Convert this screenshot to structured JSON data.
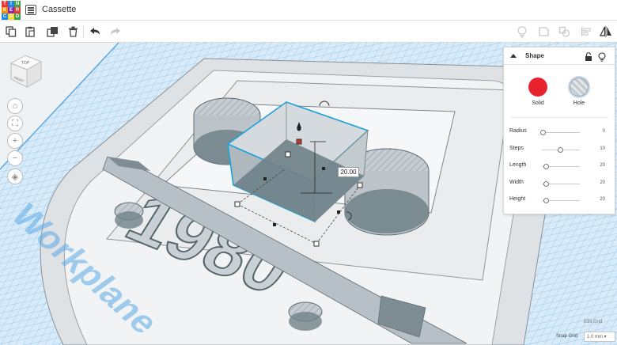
{
  "app": {
    "logo_letters": [
      "T",
      "I",
      "N",
      "K",
      "E",
      "R",
      "C",
      "A",
      "D"
    ],
    "document_title": "Cassette"
  },
  "toolbar": {
    "left_tools": [
      "copy-icon",
      "paste-icon",
      "duplicate-icon",
      "trash-icon",
      "undo-icon",
      "redo-icon"
    ],
    "right_tools": [
      "lightbulb-icon",
      "group-icon",
      "ungroup-icon",
      "align-icon",
      "mirror-icon"
    ]
  },
  "view_controls": {
    "cube_top": "TOP",
    "cube_front": "FRONT",
    "buttons": [
      "home-icon",
      "fit-icon",
      "zoom-in-icon",
      "zoom-out-icon",
      "perspective-icon"
    ]
  },
  "workspace": {
    "workplane_label": "Workplane",
    "engraved_text": "1980",
    "dimension_value": "20.00"
  },
  "shape_panel": {
    "title": "Shape",
    "solid_label": "Solid",
    "hole_label": "Hole",
    "solid_color": "#e9222f",
    "hole_color": "#c2c9cf",
    "properties": [
      {
        "label": "Radius",
        "value": "0",
        "fraction": 0.0
      },
      {
        "label": "Steps",
        "value": "10",
        "fraction": 0.5
      },
      {
        "label": "Length",
        "value": "20",
        "fraction": 0.1
      },
      {
        "label": "Width",
        "value": "20",
        "fraction": 0.1
      },
      {
        "label": "Height",
        "value": "20",
        "fraction": 0.1
      }
    ]
  },
  "footer": {
    "edit_grid": "Edit Grid",
    "snap_label": "Snap Grid",
    "snap_value": "1.0 mm ▾"
  },
  "colors": {
    "grid_blue": "#5aa9e6",
    "selection_cyan": "#1aa3d9",
    "hole_gray": "#6f8288"
  }
}
